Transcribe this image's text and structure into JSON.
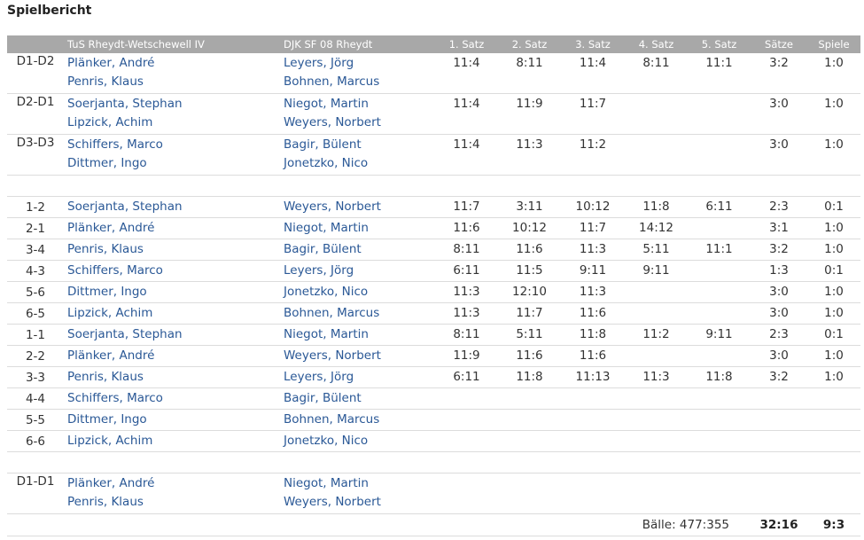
{
  "title": "Spielbericht",
  "headers": {
    "pos": "",
    "home_team": "TuS Rheydt-Wetschewell IV",
    "away_team": "DJK SF 08 Rheydt",
    "sets": [
      "1. Satz",
      "2. Satz",
      "3. Satz",
      "4. Satz",
      "5. Satz"
    ],
    "saetze": "Sätze",
    "spiele": "Spiele"
  },
  "rows": [
    {
      "type": "double",
      "pos": "D1-D2",
      "home": [
        "Plänker, André",
        "Penris, Klaus"
      ],
      "away": [
        "Leyers, Jörg",
        "Bohnen, Marcus"
      ],
      "sets": [
        "11:4",
        "8:11",
        "11:4",
        "8:11",
        "11:1"
      ],
      "saetze": "3:2",
      "spiele": "1:0"
    },
    {
      "type": "double",
      "pos": "D2-D1",
      "home": [
        "Soerjanta, Stephan",
        "Lipzick, Achim"
      ],
      "away": [
        "Niegot, Martin",
        "Weyers, Norbert"
      ],
      "sets": [
        "11:4",
        "11:9",
        "11:7",
        "",
        ""
      ],
      "saetze": "3:0",
      "spiele": "1:0"
    },
    {
      "type": "double",
      "pos": "D3-D3",
      "home": [
        "Schiffers, Marco",
        "Dittmer, Ingo"
      ],
      "away": [
        "Bagir, Bülent",
        "Jonetzko, Nico"
      ],
      "sets": [
        "11:4",
        "11:3",
        "11:2",
        "",
        ""
      ],
      "saetze": "3:0",
      "spiele": "1:0"
    },
    {
      "type": "gap"
    },
    {
      "type": "single",
      "pos": "1-2",
      "home": "Soerjanta, Stephan",
      "away": "Weyers, Norbert",
      "sets": [
        "11:7",
        "3:11",
        "10:12",
        "11:8",
        "6:11"
      ],
      "saetze": "2:3",
      "spiele": "0:1"
    },
    {
      "type": "single",
      "pos": "2-1",
      "home": "Plänker, André",
      "away": "Niegot, Martin",
      "sets": [
        "11:6",
        "10:12",
        "11:7",
        "14:12",
        ""
      ],
      "saetze": "3:1",
      "spiele": "1:0"
    },
    {
      "type": "single",
      "pos": "3-4",
      "home": "Penris, Klaus",
      "away": "Bagir, Bülent",
      "sets": [
        "8:11",
        "11:6",
        "11:3",
        "5:11",
        "11:1"
      ],
      "saetze": "3:2",
      "spiele": "1:0"
    },
    {
      "type": "single",
      "pos": "4-3",
      "home": "Schiffers, Marco",
      "away": "Leyers, Jörg",
      "sets": [
        "6:11",
        "11:5",
        "9:11",
        "9:11",
        ""
      ],
      "saetze": "1:3",
      "spiele": "0:1"
    },
    {
      "type": "single",
      "pos": "5-6",
      "home": "Dittmer, Ingo",
      "away": "Jonetzko, Nico",
      "sets": [
        "11:3",
        "12:10",
        "11:3",
        "",
        ""
      ],
      "saetze": "3:0",
      "spiele": "1:0"
    },
    {
      "type": "single",
      "pos": "6-5",
      "home": "Lipzick, Achim",
      "away": "Bohnen, Marcus",
      "sets": [
        "11:3",
        "11:7",
        "11:6",
        "",
        ""
      ],
      "saetze": "3:0",
      "spiele": "1:0"
    },
    {
      "type": "single",
      "pos": "1-1",
      "home": "Soerjanta, Stephan",
      "away": "Niegot, Martin",
      "sets": [
        "8:11",
        "5:11",
        "11:8",
        "11:2",
        "9:11"
      ],
      "saetze": "2:3",
      "spiele": "0:1"
    },
    {
      "type": "single",
      "pos": "2-2",
      "home": "Plänker, André",
      "away": "Weyers, Norbert",
      "sets": [
        "11:9",
        "11:6",
        "11:6",
        "",
        ""
      ],
      "saetze": "3:0",
      "spiele": "1:0"
    },
    {
      "type": "single",
      "pos": "3-3",
      "home": "Penris, Klaus",
      "away": "Leyers, Jörg",
      "sets": [
        "6:11",
        "11:8",
        "11:13",
        "11:3",
        "11:8"
      ],
      "saetze": "3:2",
      "spiele": "1:0"
    },
    {
      "type": "single",
      "pos": "4-4",
      "home": "Schiffers, Marco",
      "away": "Bagir, Bülent",
      "sets": [
        "",
        "",
        "",
        "",
        ""
      ],
      "saetze": "",
      "spiele": ""
    },
    {
      "type": "single",
      "pos": "5-5",
      "home": "Dittmer, Ingo",
      "away": "Bohnen, Marcus",
      "sets": [
        "",
        "",
        "",
        "",
        ""
      ],
      "saetze": "",
      "spiele": ""
    },
    {
      "type": "single",
      "pos": "6-6",
      "home": "Lipzick, Achim",
      "away": "Jonetzko, Nico",
      "sets": [
        "",
        "",
        "",
        "",
        ""
      ],
      "saetze": "",
      "spiele": ""
    },
    {
      "type": "gap"
    },
    {
      "type": "double",
      "pos": "D1-D1",
      "home": [
        "Plänker, André",
        "Penris, Klaus"
      ],
      "away": [
        "Niegot, Martin",
        "Weyers, Norbert"
      ],
      "sets": [
        "",
        "",
        "",
        "",
        ""
      ],
      "saetze": "",
      "spiele": ""
    }
  ],
  "totals": {
    "baelle": "Bälle: 477:355",
    "saetze": "32:16",
    "spiele": "9:3"
  },
  "colors": {
    "header_bg": "#a8a8a8",
    "player_link": "#2a5896",
    "row_border": "#dcdcdc"
  }
}
